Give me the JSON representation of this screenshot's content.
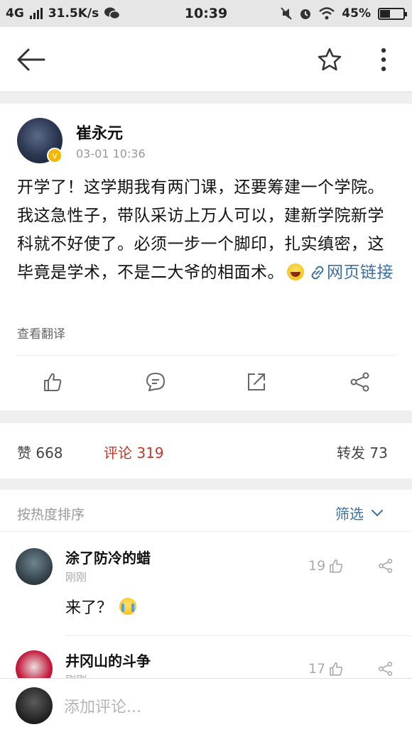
{
  "status_bar": {
    "network": "4G",
    "speed": "31.5K/s",
    "time": "10:39",
    "battery_percent": "45%",
    "battery_level": 0.45
  },
  "toolbar": {
    "back_icon": "arrow-left-icon",
    "favorite_icon": "star-icon",
    "more_icon": "more-vertical-icon"
  },
  "post": {
    "author": "崔永元",
    "verified_badge": "v",
    "timestamp": "03-01 10:36",
    "text": "开学了！这学期我有两门课，还要筹建一个学院。我这急性子，带队采访上万人可以，建新学院新学科就不好使了。必须一步一个脚印，扎实缜密，这毕竟是学术，不是二大爷的相面术。",
    "link_label": "网页链接",
    "translate_label": "查看翻译",
    "actions": [
      "like-icon",
      "comment-icon",
      "forward-icon",
      "share-icon"
    ]
  },
  "stats": {
    "likes_label": "赞",
    "likes_count": "668",
    "comments_label": "评论",
    "comments_count": "319",
    "reposts_label": "转发",
    "reposts_count": "73"
  },
  "comments": {
    "sort_label": "按热度排序",
    "filter_label": "筛选",
    "items": [
      {
        "name": "涂了防冷的蜡",
        "time": "刚刚",
        "likes": "19",
        "text": "来了？"
      },
      {
        "name": "井冈山的斗争",
        "time": "刚刚",
        "likes": "17",
        "text": ""
      }
    ]
  },
  "composer": {
    "placeholder": "添加评论..."
  },
  "colors": {
    "accent_red": "#c0392b",
    "link_blue": "#3d6f9f",
    "verified_gold": "#f5b800"
  }
}
